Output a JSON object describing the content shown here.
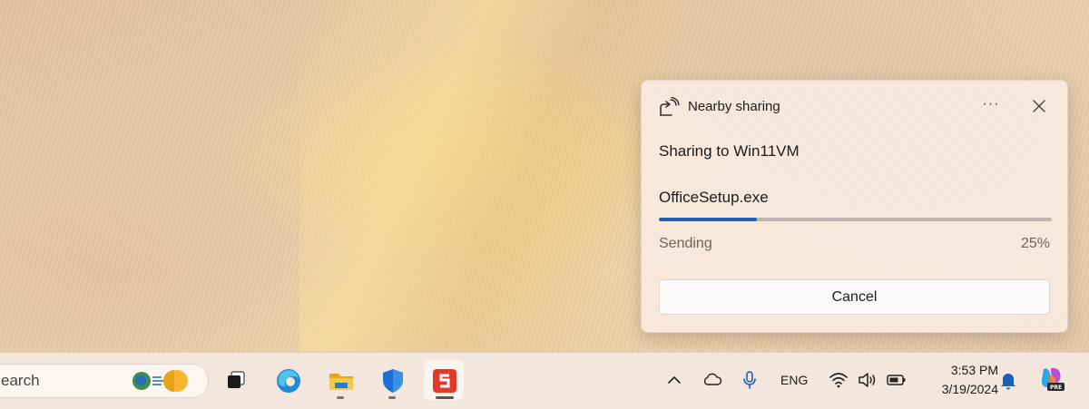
{
  "notification": {
    "title": "Nearby sharing",
    "more_label": "···",
    "sharing_to": "Sharing to Win11VM",
    "file_name": "OfficeSetup.exe",
    "status": "Sending",
    "progress_percent": 25,
    "progress_text": "25%",
    "cancel_label": "Cancel"
  },
  "taskbar": {
    "search_text": "earch",
    "apps": [
      {
        "name": "task-view",
        "icon": "task-view-icon"
      },
      {
        "name": "edge",
        "icon": "edge-icon",
        "running": false
      },
      {
        "name": "file-explorer",
        "icon": "folder-icon",
        "running": true
      },
      {
        "name": "windows-security",
        "icon": "shield-icon",
        "running": true
      },
      {
        "name": "snagit",
        "icon": "snagit-icon",
        "running": true,
        "active": true
      }
    ],
    "tray": {
      "chevron": "chevron-up-icon",
      "cloud": "onedrive-icon",
      "mic": "microphone-icon",
      "language": "ENG",
      "wifi": "wifi-icon",
      "volume": "speaker-icon",
      "battery": "battery-icon",
      "time": "3:53 PM",
      "date": "3/19/2024",
      "bell": "notification-bell-icon",
      "copilot": "copilot-pre-icon"
    }
  },
  "colors": {
    "accent": "#1a5fb4",
    "flyout_bg": "#f7e8dc",
    "taskbar_bg": "#f3e6dd"
  }
}
